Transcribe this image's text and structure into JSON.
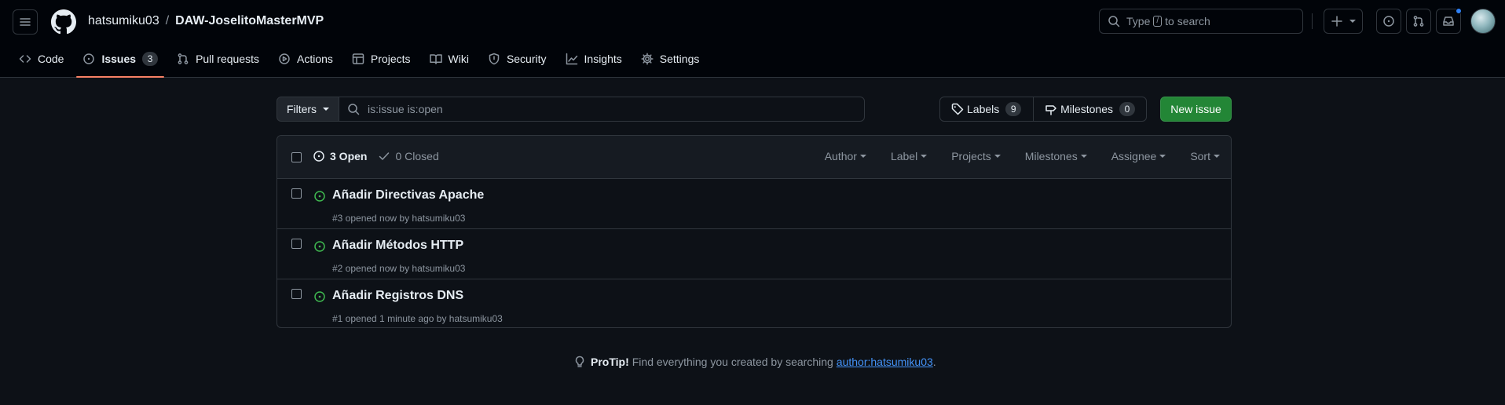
{
  "header": {
    "owner": "hatsumiku03",
    "separator": "/",
    "repo": "DAW-JoselitoMasterMVP",
    "search_prefix": "Type",
    "search_key": "/",
    "search_suffix": "to search"
  },
  "tabs": [
    {
      "label": "Code",
      "icon": "code-icon"
    },
    {
      "label": "Issues",
      "icon": "issue-opened-icon",
      "count": "3",
      "selected": true
    },
    {
      "label": "Pull requests",
      "icon": "git-pull-request-icon"
    },
    {
      "label": "Actions",
      "icon": "play-icon"
    },
    {
      "label": "Projects",
      "icon": "table-icon"
    },
    {
      "label": "Wiki",
      "icon": "book-icon"
    },
    {
      "label": "Security",
      "icon": "shield-icon"
    },
    {
      "label": "Insights",
      "icon": "graph-icon"
    },
    {
      "label": "Settings",
      "icon": "gear-icon"
    }
  ],
  "filterbar": {
    "filters_label": "Filters",
    "query": "is:issue is:open",
    "labels_label": "Labels",
    "labels_count": "9",
    "milestones_label": "Milestones",
    "milestones_count": "0",
    "new_issue_label": "New issue"
  },
  "issues_header": {
    "open_label": "3 Open",
    "closed_label": "0 Closed",
    "sorts": [
      "Author",
      "Label",
      "Projects",
      "Milestones",
      "Assignee",
      "Sort"
    ]
  },
  "issues": [
    {
      "title": "Añadir Directivas Apache",
      "meta": "#3 opened now by hatsumiku03"
    },
    {
      "title": "Añadir Métodos HTTP",
      "meta": "#2 opened now by hatsumiku03"
    },
    {
      "title": "Añadir Registros DNS",
      "meta": "#1 opened 1 minute ago by hatsumiku03"
    }
  ],
  "protip": {
    "lead": "ProTip!",
    "text": "Find everything you created by searching",
    "link": "author:hatsumiku03",
    "end": "."
  },
  "colors": {
    "background": "#0d1117",
    "header_bg": "#010409",
    "accent_tab": "#f78166",
    "open_green": "#3fb950",
    "button_green": "#238636",
    "link_blue": "#4493f8"
  }
}
